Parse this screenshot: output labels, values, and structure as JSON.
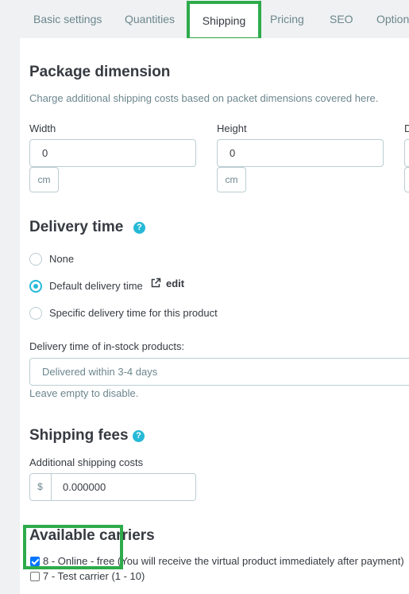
{
  "tabs": [
    {
      "label": "Basic settings"
    },
    {
      "label": "Quantities"
    },
    {
      "label": "Shipping"
    },
    {
      "label": "Pricing"
    },
    {
      "label": "SEO"
    },
    {
      "label": "Options"
    }
  ],
  "package": {
    "title": "Package dimension",
    "description": "Charge additional shipping costs based on packet dimensions covered here.",
    "width": {
      "label": "Width",
      "value": "0",
      "unit": "cm"
    },
    "height": {
      "label": "Height",
      "value": "0",
      "unit": "cm"
    },
    "depth": {
      "label": "D"
    }
  },
  "delivery": {
    "title": "Delivery time",
    "help": "?",
    "options": [
      {
        "label": "None",
        "checked": false
      },
      {
        "label": "Default delivery time",
        "checked": true,
        "edit_label": "edit"
      },
      {
        "label": "Specific delivery time for this product",
        "checked": false
      }
    ],
    "instock_label": "Delivery time of in-stock products:",
    "instock_placeholder": "Delivered within 3-4 days",
    "hint": "Leave empty to disable."
  },
  "fees": {
    "title": "Shipping fees",
    "help": "?",
    "label": "Additional shipping costs",
    "currency": "$",
    "value": "0.000000"
  },
  "carriers": {
    "title": "Available carriers",
    "items": [
      {
        "label": "8 - Online - free (You will receive the virtual product immediately after payment)",
        "checked": true
      },
      {
        "label": "7 - Test carrier (1 - 10)",
        "checked": false
      }
    ]
  },
  "colors": {
    "accent": "#25b9d7",
    "highlight": "#2eab4b"
  }
}
